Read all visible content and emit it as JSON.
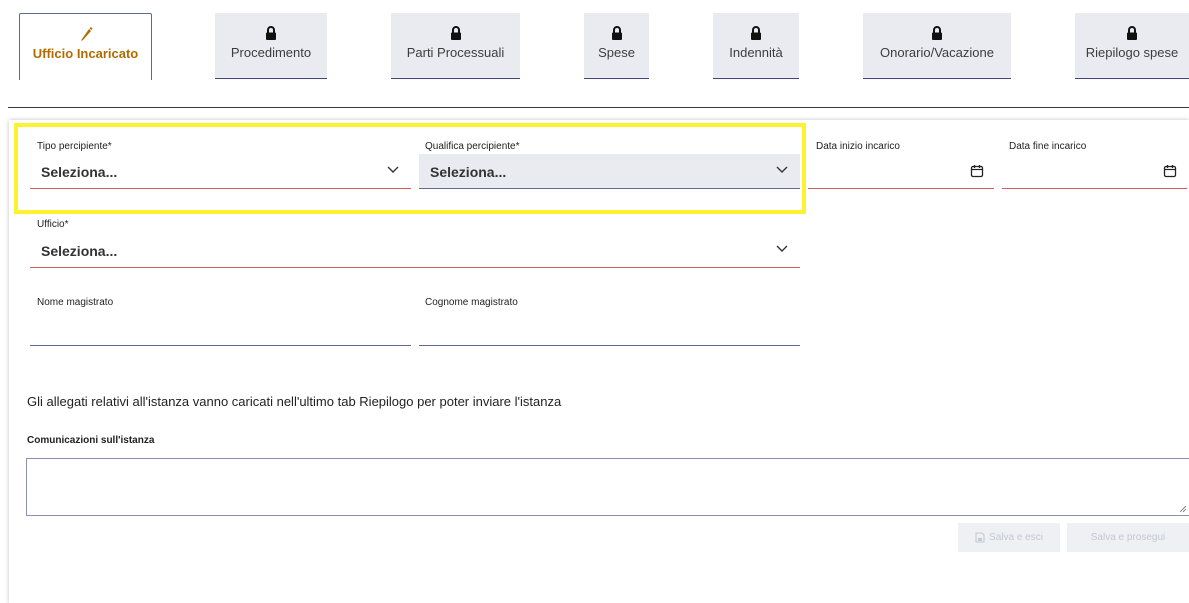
{
  "tabs": [
    {
      "label": "Ufficio Incaricato",
      "icon": "pencil-icon",
      "active": true
    },
    {
      "label": "Procedimento",
      "icon": "lock-icon"
    },
    {
      "label": "Parti Processuali",
      "icon": "lock-icon"
    },
    {
      "label": "Spese",
      "icon": "lock-icon"
    },
    {
      "label": "Indennità",
      "icon": "lock-icon"
    },
    {
      "label": "Onorario/Vacazione",
      "icon": "lock-icon"
    },
    {
      "label": "Riepilogo spese",
      "icon": "lock-icon"
    }
  ],
  "form": {
    "tipo_percipiente": {
      "label": "Tipo percipiente*",
      "value": "Seleziona..."
    },
    "qualifica_percipiente": {
      "label": "Qualifica percipiente*",
      "value": "Seleziona..."
    },
    "data_inizio": {
      "label": "Data inizio incarico",
      "value": ""
    },
    "data_fine": {
      "label": "Data fine incarico",
      "value": ""
    },
    "ufficio": {
      "label": "Ufficio*",
      "value": "Seleziona..."
    },
    "nome_magistrato": {
      "label": "Nome magistrato",
      "value": ""
    },
    "cognome_magistrato": {
      "label": "Cognome magistrato",
      "value": ""
    }
  },
  "note": "Gli allegati relativi all'istanza vanno caricati nell'ultimo tab Riepilogo per poter inviare l'istanza",
  "comunicazioni": {
    "label": "Comunicazioni sull'istanza",
    "value": ""
  },
  "buttons": {
    "save_exit": "Salva e esci",
    "save_next": "Salva e prosegui"
  },
  "colors": {
    "active_tab": "#b26b00",
    "highlight": "#fdf231",
    "error_underline": "#d55a5a",
    "navy": "#3c4a7a"
  }
}
